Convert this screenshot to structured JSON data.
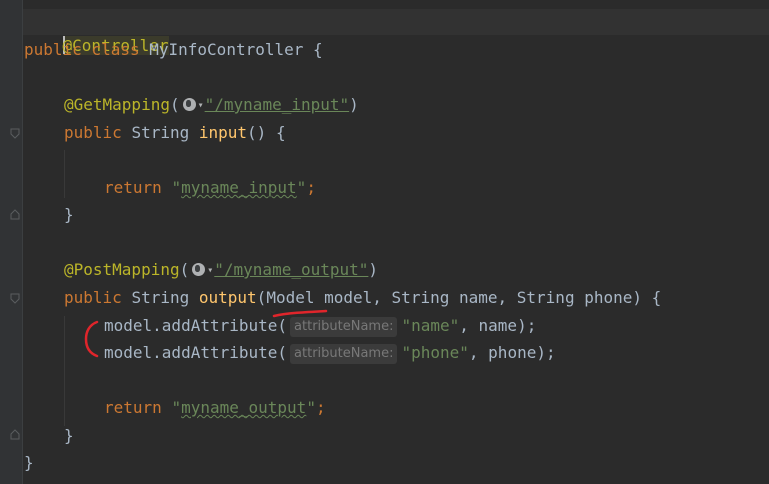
{
  "code": {
    "lines": {
      "l1_annotation": "@Controller",
      "l2_class_kw1": "public",
      "l2_class_kw2": "class",
      "l2_class_name": "MyInfoController",
      "l2_brace": "{",
      "l4_annotation": "@GetMapping",
      "l4_paren_open": "(",
      "l4_url": "\"/myname_input\"",
      "l4_paren_close": ")",
      "l5_public": "public",
      "l5_type": "String",
      "l5_method": "input",
      "l5_sig": "() {",
      "l7_return": "return",
      "l7_str_q1": "\"",
      "l7_str": "myname_input",
      "l7_str_q2": "\"",
      "l7_semi": ";",
      "l8_close": "}",
      "l10_annotation": "@PostMapping",
      "l10_paren_open": "(",
      "l10_url": "\"/myname_output\"",
      "l10_paren_close": ")",
      "l11_public": "public",
      "l11_type": "String",
      "l11_method": "output",
      "l11_paren": "(",
      "l11_model_type": "Model",
      "l11_params": " model, String name, String phone) {",
      "l12_call": "model.addAttribute(",
      "l12_hint": "attributeName:",
      "l12_str": "\"name\"",
      "l12_rest": ", name);",
      "l13_call": "model.addAttribute(",
      "l13_hint": "attributeName:",
      "l13_str": "\"phone\"",
      "l13_rest": ", phone);",
      "l15_return": "return",
      "l15_str_q1": "\"",
      "l15_str": "myname_output",
      "l15_str_q2": "\"",
      "l15_semi": ";",
      "l16_close": "}",
      "l17_close": "}"
    }
  },
  "colors": {
    "background": "#2b2b2b",
    "keyword": "#cc7832",
    "annotation": "#bbb529",
    "method": "#ffc66d",
    "string": "#6a8759",
    "text": "#a9b7c6",
    "markup_red": "#e0252b"
  },
  "icons": {
    "web_endpoint": "globe-icon",
    "dropdown": "chevron-down-icon",
    "fold": "fold-marker-icon"
  }
}
